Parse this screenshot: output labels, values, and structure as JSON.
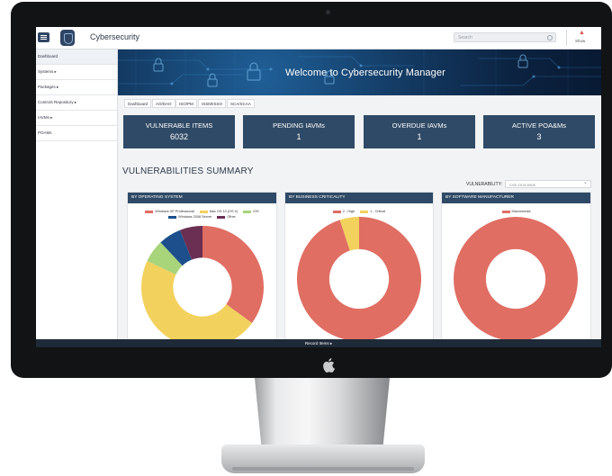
{
  "header": {
    "app_title": "Cybersecurity",
    "search_placeholder": "Search",
    "show_label": "Show"
  },
  "sidebar": {
    "items": [
      {
        "label": "Dashboard"
      },
      {
        "label": "Systems ▸"
      },
      {
        "label": "Packages ▸"
      },
      {
        "label": "Controls Repository ▸"
      },
      {
        "label": "IAVMs ▸"
      },
      {
        "label": "POAMs"
      }
    ]
  },
  "banner": {
    "text": "Welcome to Cybersecurity Manager"
  },
  "tabs": [
    "Dashboard",
    "AO/DAO",
    "ISO/PM",
    "ISSM/ISSO",
    "SCA/SCAA"
  ],
  "cards": [
    {
      "title": "VULNERABLE ITEMS",
      "value": "6032"
    },
    {
      "title": "PENDING IAVMs",
      "value": "1"
    },
    {
      "title": "OVERDUE IAVMs",
      "value": "1"
    },
    {
      "title": "ACTIVE POA&Ms",
      "value": "3"
    }
  ],
  "summary": {
    "title": "VULNERABILITIES SUMMARY",
    "filter_label": "VULNERABILITY:",
    "filter_value": "CVE-2015-6908"
  },
  "colors": {
    "red": "#e06e63",
    "yellow": "#f2d15c",
    "green": "#a8d47a",
    "blue": "#1c4f8c",
    "purple": "#6a2f52",
    "navy": "#2f4a66"
  },
  "panels": [
    {
      "title": "BY OPERATING SYSTEM",
      "legend": [
        {
          "label": "Windows XP Professional",
          "color": "#e06e63"
        },
        {
          "label": "Mac OS 10 (OS X)",
          "color": "#f2d15c"
        },
        {
          "label": "iOS",
          "color": "#a8d47a"
        },
        {
          "label": "Windows 2008 Server",
          "color": "#1c4f8c"
        },
        {
          "label": "Other",
          "color": "#6a2f52"
        }
      ],
      "chart_data": {
        "type": "pie",
        "categories": [
          "Windows XP Professional",
          "Mac OS 10 (OS X)",
          "iOS",
          "Windows 2008 Server",
          "Other"
        ],
        "values": [
          35,
          47,
          6,
          6,
          6
        ]
      }
    },
    {
      "title": "BY BUSINESS CRITICALITY",
      "legend": [
        {
          "label": "2 - High",
          "color": "#e06e63"
        },
        {
          "label": "1 - Critical",
          "color": "#f2d15c"
        }
      ],
      "chart_data": {
        "type": "pie",
        "categories": [
          "2 - High",
          "1 - Critical"
        ],
        "values": [
          95,
          5
        ]
      }
    },
    {
      "title": "BY SOFTWARE MANUFACTURER",
      "legend": [
        {
          "label": "Macromedia",
          "color": "#e06e63"
        }
      ],
      "chart_data": {
        "type": "pie",
        "categories": [
          "Macromedia"
        ],
        "values": [
          100
        ]
      }
    }
  ],
  "bottom_bar": {
    "label": "Record Items ▸"
  }
}
